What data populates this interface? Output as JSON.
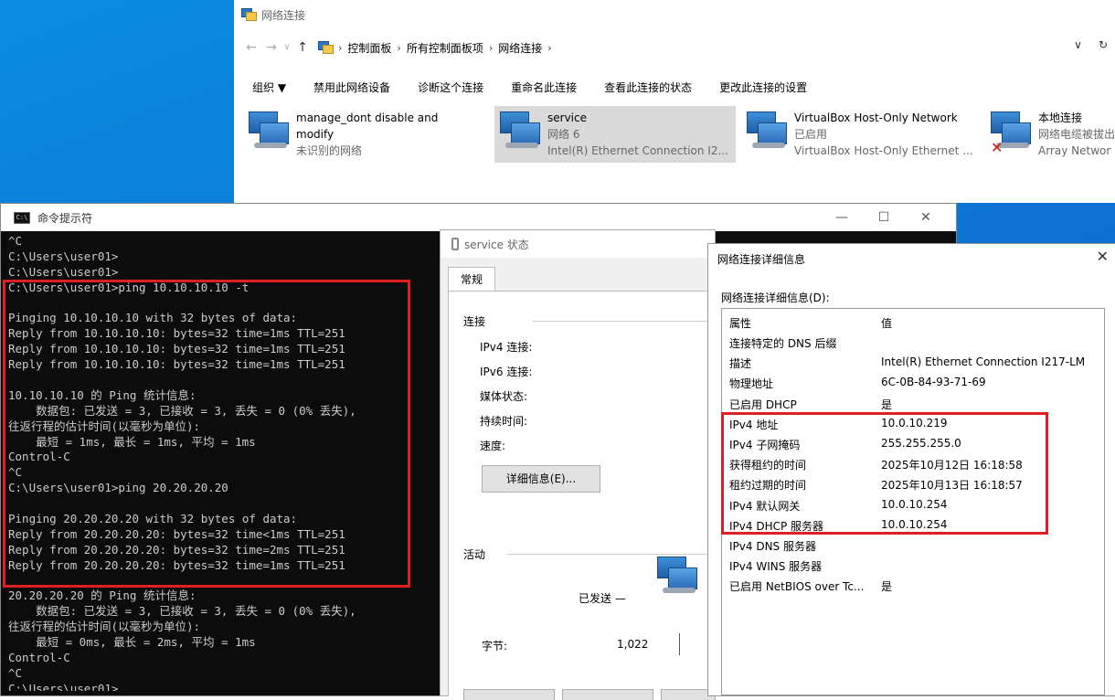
{
  "explorer": {
    "title": "网络连接",
    "breadcrumb": [
      "控制面板",
      "所有控制面板项",
      "网络连接"
    ],
    "toolbar": [
      "组织 ▼",
      "禁用此网络设备",
      "诊断这个连接",
      "重命名此连接",
      "查看此连接的状态",
      "更改此连接的设置"
    ],
    "connections": [
      {
        "name": "manage_dont disable and modify",
        "line2": "",
        "line3": "未识别的网络"
      },
      {
        "name": "service",
        "line2": "网络 6",
        "line3": "Intel(R) Ethernet Connection I2..."
      },
      {
        "name": "VirtualBox Host-Only Network",
        "line2": "已启用",
        "line3": "VirtualBox Host-Only Ethernet ..."
      },
      {
        "name": "本地连接",
        "line2": "网络电缆被拔出",
        "line3": "Array Networ"
      }
    ]
  },
  "cmd": {
    "title": "命令提示符",
    "lines": [
      "^C",
      "C:\\Users\\user01>",
      "C:\\Users\\user01>",
      "C:\\Users\\user01>ping 10.10.10.10 -t",
      "",
      "Pinging 10.10.10.10 with 32 bytes of data:",
      "Reply from 10.10.10.10: bytes=32 time=1ms TTL=251",
      "Reply from 10.10.10.10: bytes=32 time=1ms TTL=251",
      "Reply from 10.10.10.10: bytes=32 time=1ms TTL=251",
      "",
      "10.10.10.10 的 Ping 统计信息:",
      "    数据包: 已发送 = 3, 已接收 = 3, 丢失 = 0 (0% 丢失),",
      "往返行程的估计时间(以毫秒为单位):",
      "    最短 = 1ms, 最长 = 1ms, 平均 = 1ms",
      "Control-C",
      "^C",
      "C:\\Users\\user01>ping 20.20.20.20",
      "",
      "Pinging 20.20.20.20 with 32 bytes of data:",
      "Reply from 20.20.20.20: bytes=32 time<1ms TTL=251",
      "Reply from 20.20.20.20: bytes=32 time=2ms TTL=251",
      "Reply from 20.20.20.20: bytes=32 time=1ms TTL=251",
      "",
      "20.20.20.20 的 Ping 统计信息:",
      "    数据包: 已发送 = 3, 已接收 = 3, 丢失 = 0 (0% 丢失),",
      "往返行程的估计时间(以毫秒为单位):",
      "    最短 = 0ms, 最长 = 2ms, 平均 = 1ms",
      "Control-C",
      "^C",
      "C:\\Users\\user01>"
    ]
  },
  "service": {
    "title": "service 状态",
    "tab": "常规",
    "connection_group": "连接",
    "rows": [
      "IPv4 连接:",
      "IPv6 连接:",
      "媒体状态:",
      "持续时间:",
      "速度:"
    ],
    "details_button": "详细信息(E)...",
    "activity_group": "活动",
    "sent_label": "已发送 —",
    "bytes_label": "字节:",
    "bytes_value": "1,022"
  },
  "details": {
    "title": "网络连接详细信息",
    "list_label": "网络连接详细信息(D):",
    "col_property": "属性",
    "col_value": "值",
    "rows": [
      {
        "k": "连接特定的 DNS 后缀",
        "v": ""
      },
      {
        "k": "描述",
        "v": "Intel(R) Ethernet Connection I217-LM"
      },
      {
        "k": "物理地址",
        "v": "6C-0B-84-93-71-69"
      },
      {
        "k": "已启用 DHCP",
        "v": "是"
      },
      {
        "k": "IPv4 地址",
        "v": "10.0.10.219"
      },
      {
        "k": "IPv4 子网掩码",
        "v": "255.255.255.0"
      },
      {
        "k": "获得租约的时间",
        "v": "2025年10月12日 16:18:58"
      },
      {
        "k": "租约过期的时间",
        "v": "2025年10月13日 16:18:57"
      },
      {
        "k": "IPv4 默认网关",
        "v": "10.0.10.254"
      },
      {
        "k": "IPv4 DHCP 服务器",
        "v": "10.0.10.254"
      },
      {
        "k": "IPv4 DNS 服务器",
        "v": ""
      },
      {
        "k": "IPv4 WINS 服务器",
        "v": ""
      },
      {
        "k": "已启用 NetBIOS over Tc...",
        "v": "是"
      }
    ]
  },
  "colors": {
    "highlight_box": "#e02020",
    "desktop": "#0c76d4",
    "console_bg": "#0c0c0c",
    "console_text": "#cccccc"
  }
}
